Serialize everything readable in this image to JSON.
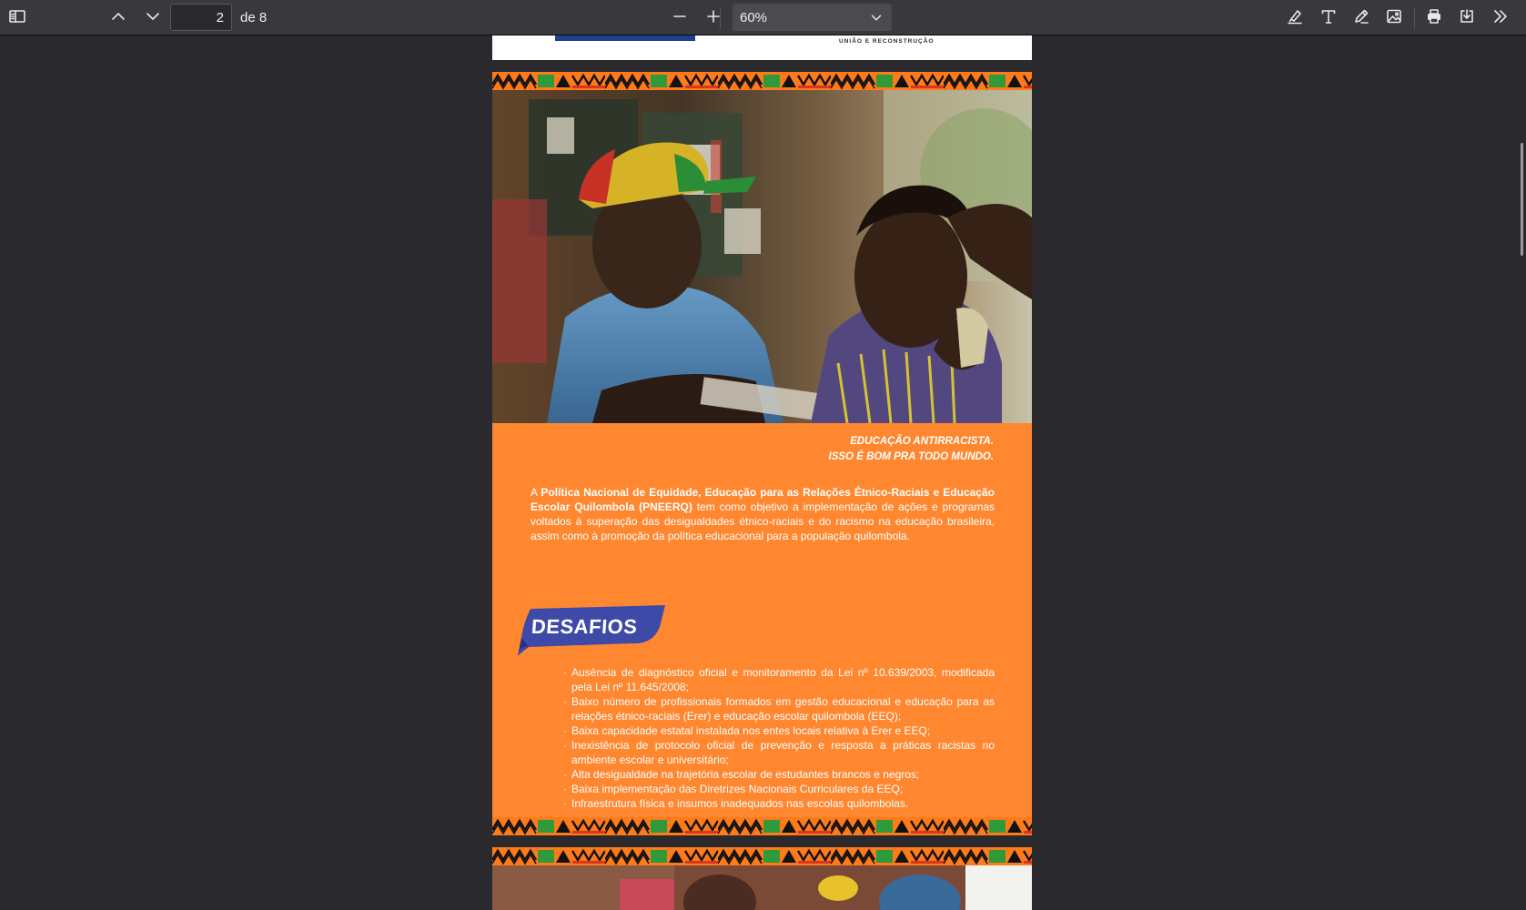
{
  "toolbar": {
    "page_current": "2",
    "page_total_text": "de 8",
    "zoom_value": "60%",
    "icons": [
      "sidebar-toggle-icon",
      "arrow-up-icon",
      "arrow-down-icon",
      "zoom-out-icon",
      "zoom-in-icon",
      "highlight-icon",
      "text-icon",
      "draw-icon",
      "image-icon",
      "print-icon",
      "save-icon",
      "more-tools-icon"
    ]
  },
  "previous_page": {
    "tagline": "UNIÃO E RECONSTRUÇÃO"
  },
  "document": {
    "slogan_line1": "EDUCAÇÃO ANTIRRACISTA.",
    "slogan_line2": "ISSO É BOM PRA TODO MUNDO.",
    "intro_prefix": "A ",
    "intro_bold": "Política Nacional de Equidade, Educação para as Relações Étnico-Raciais e Educação Escolar Quilombola (PNEERQ)",
    "intro_rest": " tem como objetivo a implementação de ações e programas voltados à superação das desigualdades étnico-raciais e do racismo na educação brasileira, assim como à promoção da política educacional para a população quilombola.",
    "section_title": "DESAFIOS",
    "challenges": [
      "Ausência de diagnóstico oficial e monitoramento da Lei nº 10.639/2003, modificada pela Lei nº 11.645/2008;",
      "Baixo número de profissionais formados em gestão educacional e educação para as relações étnico-raciais (Erer) e educação escolar quilombola (EEQ);",
      "Baixa capacidade estatal instalada nos entes locais relativa à Erer e EEQ;",
      "Inexistência de protocolo oficial de prevenção e resposta a práticas racistas no ambiente escolar e universitário;",
      "Alta desigualdade na trajetória escolar de estudantes brancos e negros;",
      "Baixa implementação das Diretrizes Nacionais Curriculares da EEQ;",
      "Infraestrutura física e insumos inadequados nas escolas quilombolas."
    ]
  },
  "colors": {
    "page_orange": "#ff8730",
    "badge_blue": "#3d4aa8",
    "toolbar_bg": "#38383d",
    "viewer_bg": "#2a2a2e"
  }
}
